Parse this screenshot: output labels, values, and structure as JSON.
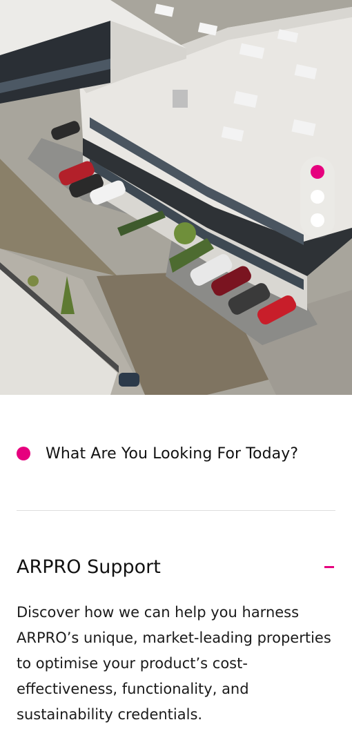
{
  "hero": {
    "image_label": "aerial-view-of-industrial-building-with-car-park",
    "carousel": {
      "slide_count": 3,
      "active_index": 0,
      "active_color": "#e6007e",
      "inactive_color": "#ffffff"
    }
  },
  "section": {
    "bullet_color": "#e6007e",
    "label": "What Are You Looking For Today?"
  },
  "accordion": {
    "title": "ARPRO Support",
    "expanded": true,
    "toggle_icon": "minus-icon",
    "toggle_color": "#e6007e",
    "body": "Discover how we can help you harness ARPRO’s unique, market-leading properties to optimise your product’s cost-effectiveness, functionality, and sustainability credentials."
  }
}
